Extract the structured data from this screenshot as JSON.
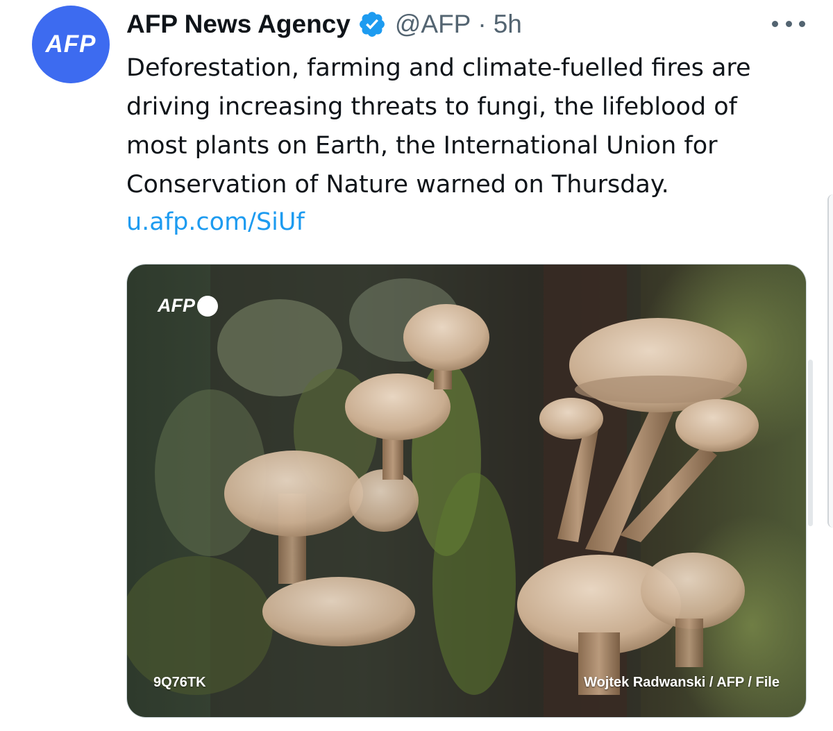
{
  "author": {
    "avatar_label": "AFP",
    "name": "AFP News Agency",
    "handle": "@AFP",
    "separator": "·",
    "time": "5h",
    "verified": true,
    "avatar_color": "#3d6bf0",
    "verified_color": "#1d9bf0"
  },
  "tweet": {
    "text_lines": [
      "Deforestation, farming and climate-fuelled fires are",
      "driving increasing threats to fungi, the lifeblood of",
      "most plants on Earth, the International Union for",
      "Conservation of Nature warned on Thursday."
    ],
    "link": "u.afp.com/SiUf",
    "link_color": "#1d9bf0"
  },
  "media": {
    "watermark": "AFP",
    "photo_id": "9Q76TK",
    "credit": "Wojtek Radwanski / AFP / File",
    "subject": "mushrooms-on-tree-bark"
  },
  "icons": [
    "verified-badge-icon",
    "more-options-icon"
  ]
}
